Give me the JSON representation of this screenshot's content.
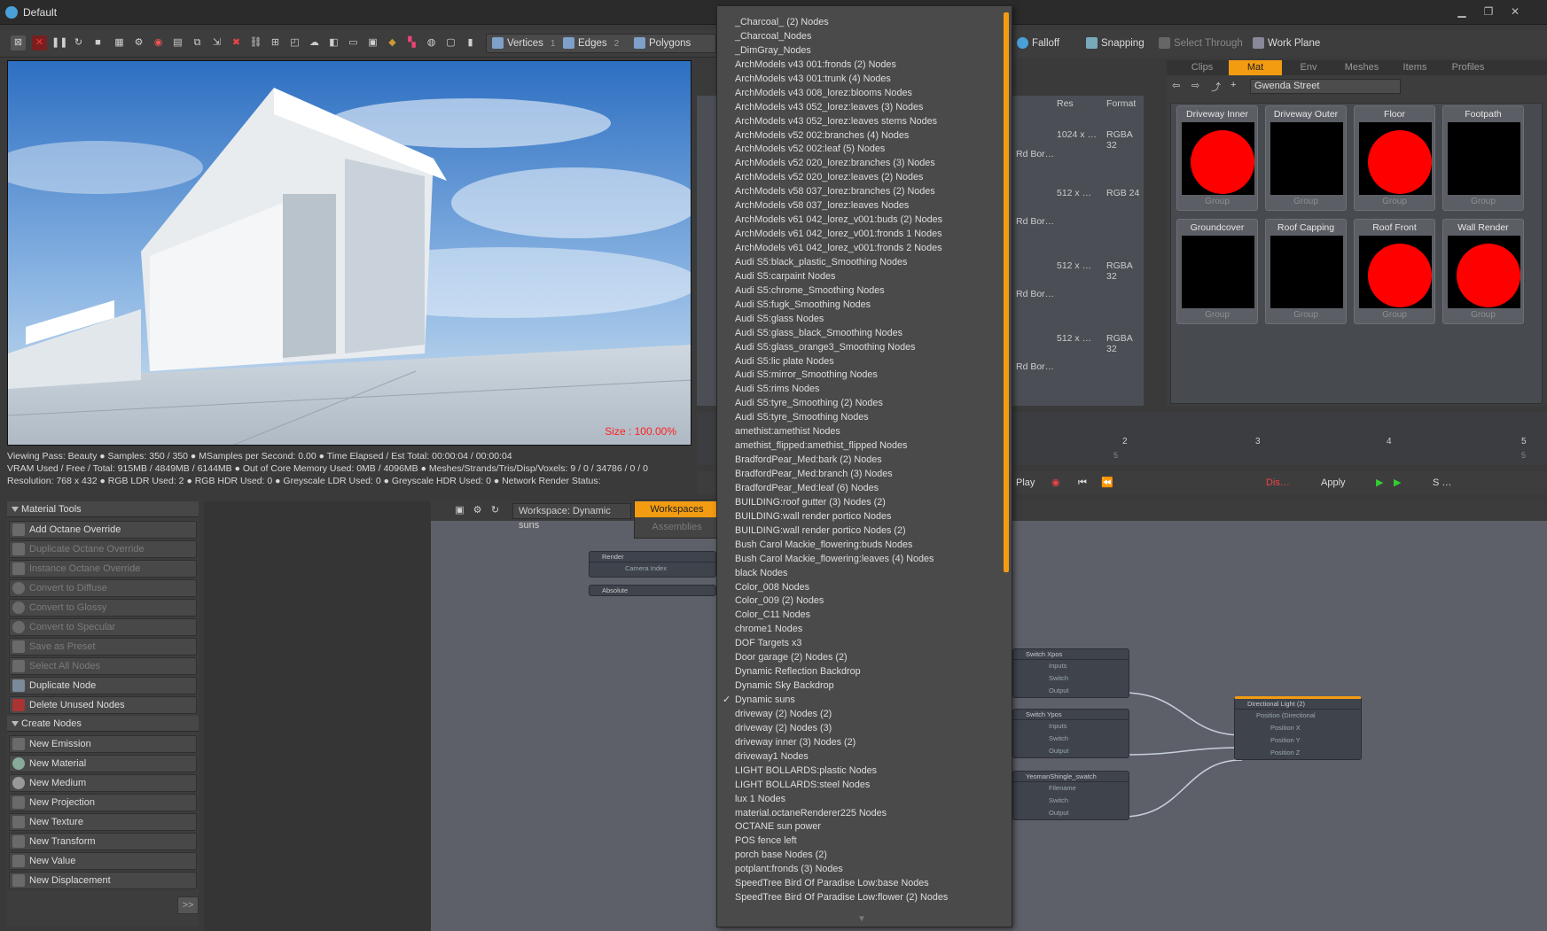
{
  "window": {
    "title": "Default",
    "controls": [
      "minimize",
      "restore",
      "close"
    ]
  },
  "toolbar": {
    "selection_modes": [
      {
        "label": "Vertices",
        "count": "1"
      },
      {
        "label": "Edges",
        "count": "2"
      },
      {
        "label": "Polygons",
        "count": ""
      }
    ],
    "right_buttons": [
      "Falloff",
      "Snapping",
      "Select Through",
      "Work Plane"
    ]
  },
  "viewport": {
    "size_label": "Size : 100.00%"
  },
  "status": {
    "line1": "Viewing Pass: Beauty ● Samples: 350 / 350 ● MSamples per Second: 0.00 ● Time Elapsed / Est Total: 00:00:04 / 00:00:04",
    "line2": "VRAM Used / Free / Total: 915MB / 4849MB / 6144MB ● Out of Core Memory Used: 0MB / 4096MB ● Meshes/Strands/Tris/Disp/Voxels: 9 / 0 / 34786 / 0 / 0",
    "line3": "Resolution: 768 x 432 ● RGB LDR Used: 2 ● RGB HDR Used: 0 ● Greyscale LDR Used: 0 ● Greyscale HDR Used: 0 ● Network Render Status:"
  },
  "material_tools": {
    "header": "Material Tools",
    "items": [
      {
        "label": "Add Octane Override",
        "enabled": true
      },
      {
        "label": "Duplicate Octane Override",
        "enabled": false
      },
      {
        "label": "Instance Octane Override",
        "enabled": false
      },
      {
        "label": "Convert to Diffuse",
        "enabled": false
      },
      {
        "label": "Convert to Glossy",
        "enabled": false
      },
      {
        "label": "Convert to Specular",
        "enabled": false
      },
      {
        "label": "Save as Preset",
        "enabled": false
      },
      {
        "label": "Select All Nodes",
        "enabled": false
      },
      {
        "label": "Duplicate Node",
        "enabled": true
      },
      {
        "label": "Delete Unused Nodes",
        "enabled": true
      }
    ]
  },
  "create_nodes": {
    "header": "Create Nodes",
    "items": [
      "New Emission",
      "New Material",
      "New Medium",
      "New Projection",
      "New Texture",
      "New Transform",
      "New Value",
      "New Displacement"
    ]
  },
  "expand_label": ">>",
  "node_graph": {
    "workspace_label": "Workspace: Dynamic suns",
    "menu": {
      "active": "Workspaces",
      "inactive": "Assemblies"
    },
    "nodes": [
      {
        "title": "Render",
        "rows": [
          "Camera Index"
        ]
      },
      {
        "title": "Absolute",
        "rows": []
      },
      {
        "title": "Switch Xpos",
        "rows": [
          "Inputs",
          "Switch",
          "Output"
        ]
      },
      {
        "title": "Switch Ypos",
        "rows": [
          "Inputs",
          "Switch",
          "Output"
        ]
      },
      {
        "title": "YeomanShingle_swatch",
        "rows": [
          "Filename",
          "Switch",
          "Output"
        ]
      },
      {
        "title": "Directional Light (2)",
        "rows": [
          "Position (Directional",
          "Position X",
          "Position Y",
          "Position Z"
        ]
      }
    ]
  },
  "dropdown": {
    "selected": "Dynamic suns",
    "items": [
      "_Charcoal_ (2) Nodes",
      "_Charcoal_Nodes",
      "_DimGray_Nodes",
      "ArchModels v43 001:fronds (2) Nodes",
      "ArchModels v43 001:trunk (4) Nodes",
      "ArchModels v43 008_lorez:blooms Nodes",
      "ArchModels v43 052_lorez:leaves (3) Nodes",
      "ArchModels v43 052_lorez:leaves stems Nodes",
      "ArchModels v52 002:branches (4) Nodes",
      "ArchModels v52 002:leaf (5) Nodes",
      "ArchModels v52 020_lorez:branches (3) Nodes",
      "ArchModels v52 020_lorez:leaves (2) Nodes",
      "ArchModels v58 037_lorez:branches (2) Nodes",
      "ArchModels v58 037_lorez:leaves Nodes",
      "ArchModels v61 042_lorez_v001:buds (2) Nodes",
      "ArchModels v61 042_lorez_v001:fronds 1 Nodes",
      "ArchModels v61 042_lorez_v001:fronds 2 Nodes",
      "Audi S5:black_plastic_Smoothing Nodes",
      "Audi S5:carpaint Nodes",
      "Audi S5:chrome_Smoothing Nodes",
      "Audi S5:fugk_Smoothing Nodes",
      "Audi S5:glass Nodes",
      "Audi S5:glass_black_Smoothing Nodes",
      "Audi S5:glass_orange3_Smoothing Nodes",
      "Audi S5:lic plate Nodes",
      "Audi S5:mirror_Smoothing Nodes",
      "Audi S5:rims Nodes",
      "Audi S5:tyre_Smoothing (2) Nodes",
      "Audi S5:tyre_Smoothing Nodes",
      "amethist:amethist Nodes",
      "amethist_flipped:amethist_flipped Nodes",
      "BradfordPear_Med:bark (2) Nodes",
      "BradfordPear_Med:branch (3) Nodes",
      "BradfordPear_Med:leaf (6) Nodes",
      "BUILDING:roof gutter (3) Nodes (2)",
      "BUILDING:wall render portico Nodes",
      "BUILDING:wall render portico Nodes (2)",
      "Bush Carol Mackie_flowering:buds Nodes",
      "Bush Carol Mackie_flowering:leaves (4) Nodes",
      "black Nodes",
      "Color_008 Nodes",
      "Color_009 (2) Nodes",
      "Color_C11 Nodes",
      "chrome1 Nodes",
      "DOF Targets x3",
      "Door garage (2) Nodes (2)",
      "Dynamic Reflection Backdrop",
      "Dynamic Sky Backdrop",
      "Dynamic suns",
      "driveway (2) Nodes (2)",
      "driveway (2) Nodes (3)",
      "driveway inner (3) Nodes (2)",
      "driveway1 Nodes",
      "LIGHT BOLLARDS:plastic Nodes",
      "LIGHT BOLLARDS:steel Nodes",
      "lux 1 Nodes",
      "material.octaneRenderer225 Nodes",
      "OCTANE sun power",
      "POS fence left",
      "porch base Nodes (2)",
      "potplant:fronds (3) Nodes",
      "SpeedTree Bird Of Paradise Low:base Nodes",
      "SpeedTree Bird Of Paradise Low:flower (2) Nodes"
    ]
  },
  "layers": {
    "columns": [
      "Res",
      "Format"
    ],
    "rows": [
      {
        "name": "Rd Bor…",
        "res": "1024 x …",
        "format": "RGBA 32"
      },
      {
        "name": "Rd Bor…",
        "res": "512 x …",
        "format": "RGB 24"
      },
      {
        "name": "Rd Bor…",
        "res": "512 x …",
        "format": "RGBA 32"
      },
      {
        "name": "Rd Bor…",
        "res": "512 x …",
        "format": "RGBA 32"
      }
    ]
  },
  "materials": {
    "tabs": [
      "Clips",
      "Mat",
      "Env",
      "Meshes",
      "Items",
      "Profiles"
    ],
    "active_tab": "Mat",
    "library": "Gwenda Street",
    "cards": [
      {
        "title": "Driveway Inner",
        "group": "Group",
        "preview": "red"
      },
      {
        "title": "Driveway Outer",
        "group": "Group",
        "preview": "black"
      },
      {
        "title": "Floor",
        "group": "Group",
        "preview": "red"
      },
      {
        "title": "Footpath",
        "group": "Group",
        "preview": "black"
      },
      {
        "title": "Groundcover",
        "group": "Group",
        "preview": "black"
      },
      {
        "title": "Roof Capping",
        "group": "Group",
        "preview": "black"
      },
      {
        "title": "Roof Front",
        "group": "Group",
        "preview": "red"
      },
      {
        "title": "Wall Render",
        "group": "Group",
        "preview": "red"
      }
    ]
  },
  "timeline": {
    "ticks": [
      "2",
      "3",
      "4",
      "5"
    ],
    "low_ticks": [
      "5",
      "5"
    ]
  },
  "transport": {
    "play": "Play",
    "dis": "Dis…",
    "apply": "Apply",
    "s": "S …"
  },
  "colors": {
    "accent": "#f39c12",
    "preview_red": "#ff0000",
    "size_label": "#ff2020"
  }
}
